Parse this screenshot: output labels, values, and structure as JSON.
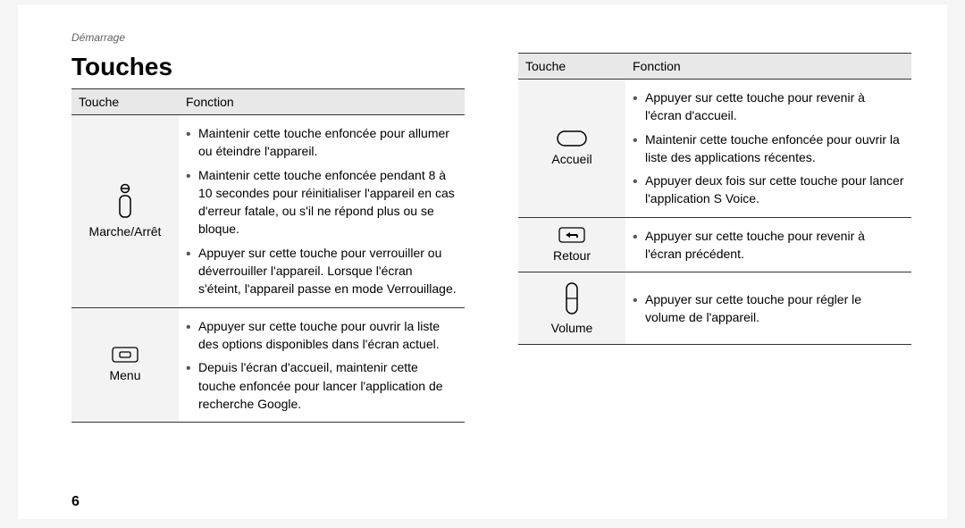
{
  "header_section": "Démarrage",
  "page_title": "Touches",
  "page_number": "6",
  "col_touche": "Touche",
  "col_fonction": "Fonction",
  "left_rows": [
    {
      "label": "Marche/Arrêt",
      "icon": "power-icon",
      "items": [
        "Maintenir cette touche enfoncée pour allumer ou éteindre l'appareil.",
        "Maintenir cette touche enfoncée pendant 8 à 10 secondes pour réinitialiser l'appareil en cas d'erreur fatale, ou s'il ne répond plus ou se bloque.",
        "Appuyer sur cette touche pour verrouiller ou déverrouiller l'appareil. Lorsque l'écran s'éteint, l'appareil passe en mode Verrouillage."
      ]
    },
    {
      "label": "Menu",
      "icon": "menu-icon",
      "items": [
        "Appuyer sur cette touche pour ouvrir la liste des options disponibles dans l'écran actuel.",
        "Depuis l'écran d'accueil, maintenir cette touche enfoncée pour lancer l'application de recherche Google."
      ]
    }
  ],
  "right_rows": [
    {
      "label": "Accueil",
      "icon": "home-icon",
      "items": [
        "Appuyer sur cette touche pour revenir à l'écran d'accueil.",
        "Maintenir cette touche enfoncée pour ouvrir la liste des applications récentes.",
        "Appuyer deux fois sur cette touche pour lancer l'application S Voice."
      ]
    },
    {
      "label": "Retour",
      "icon": "back-icon",
      "items": [
        "Appuyer sur cette touche pour revenir à l'écran précédent."
      ]
    },
    {
      "label": "Volume",
      "icon": "volume-icon",
      "items": [
        "Appuyer sur cette touche pour régler le volume de l'appareil."
      ]
    }
  ]
}
